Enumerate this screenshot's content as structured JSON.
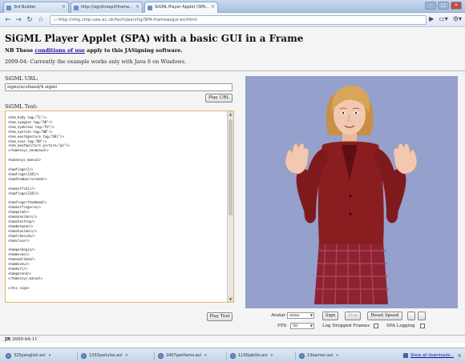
{
  "browser": {
    "tabs": [
      {
        "title": "3rd Builder"
      },
      {
        "title": "http://signlinesp3/frame..."
      },
      {
        "title": "SiGML Player Applet (SPA..."
      }
    ],
    "address": "http://vhg.cmp.uea.ac.uk/tech/jas/vhg/SPA-frameasgui-en/html",
    "window_buttons": [
      "–",
      "□",
      "×"
    ]
  },
  "page": {
    "title": "SiGML Player Applet (SPA) with a basic GUI in a Frame",
    "nb_prefix": "NB These",
    "nb_link": "conditions of use",
    "nb_suffix": "apply to this JASigning software.",
    "note": "2009-04: Currently the example works only with Java 6 on Windows.",
    "sigml_url_label": "SiGML URL:",
    "sigml_url_value": "signs/scotland/4.sigml",
    "play_url_label": "Play URL",
    "sigml_text_label": "SiGML Text:",
    "sigml_text": "<hnm_body tag=\"TL\"/>\n<hnm_eyegaze tag=\"AD\"/>\n<hnm_eyebrows tag=\"FU\"/>\n<hnm_eyelids tag=\"WB\"/>\n<hnm_mouthgesture tag=\"D01\"/>\n<hnm_nose tag=\"NU\"/>\n<hnm_mouthpicture picture=\"pe\"/>\n</hamnosys_nonmanual>\n\n<hamnosys_manual>\n\n<hamfinger2/>\n<hamfinger2345/>\n<hamthumbacrossmod/>\n\n<hamextfidir/>\n<hamfinger2345/>\n\n<hamfingerthumbmod/>\n<hamextfingerou/>\n<hampalmd/>\n<hamshoulders/>\n<hamchesttop/>\n<hambetween/>\n<hamshoulders/>\n<hamlrbeside/>\n<hamclose/>\n\n<hamparbegin/>\n<hammoveo/>\n<hamsmallmod/>\n<hammoveu/>\n<hamhalt/>\n<hamparend/>\n</hamnosys_manual>\n\n</hns_sign>",
    "play_text_label": "Play Text",
    "footer": "2009-04-11"
  },
  "controls": {
    "avatar_label": "Avatar",
    "avatar_value": "anna",
    "sign_label": "Sign",
    "stop_label": "Stop",
    "reset_speed_label": "Reset Speed",
    "fps_label": "FPS",
    "fps_value": "50",
    "log_dropped_label": "Log Dropped Frames",
    "spa_logging_label": "SPA Logging"
  },
  "downloads": {
    "items": [
      {
        "name": "325panglish.avi"
      },
      {
        "name": "1332parlulos.avi"
      },
      {
        "name": "2407parifamo.avi"
      },
      {
        "name": "1100jabitis.avi"
      },
      {
        "name": "13kamon.avi"
      }
    ],
    "show_all": "Show all downloads...",
    "close": "×"
  },
  "colors": {
    "avatar_bg": "#95a0cd",
    "cardigan": "#8a1d1f",
    "skirt": "#8d2332",
    "skin": "#f2c9b0",
    "hair": "#d9a558"
  }
}
